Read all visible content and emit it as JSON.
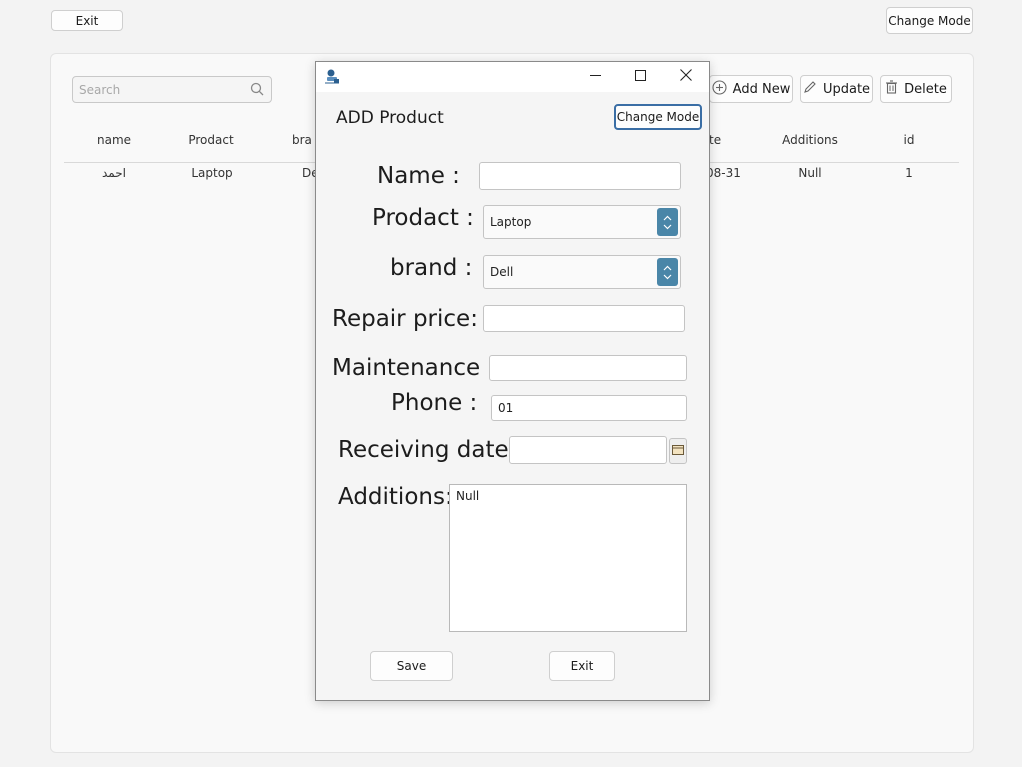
{
  "top": {
    "exit_label": "Exit",
    "change_mode_label": "Change Mode"
  },
  "toolbar": {
    "search_placeholder": "Search",
    "add_label": "Add New",
    "update_label": "Update",
    "delete_label": "Delete"
  },
  "table": {
    "headers": [
      "name",
      "Prodact",
      "bra",
      "te",
      "Additions",
      "id"
    ],
    "rows": [
      {
        "name": "احمد",
        "prodact": "Laptop",
        "brand": "De",
        "date": "08-31",
        "additions": "Null",
        "id": "1"
      }
    ]
  },
  "dialog": {
    "title": "ADD Product",
    "change_mode_label": "Change Mode",
    "labels": {
      "name": "Name :",
      "prodact": "Prodact :",
      "brand": "brand :",
      "repair_price": "Repair price:",
      "maintenance": "Maintenance :",
      "phone": "Phone :",
      "receiving_date": "Receiving date:",
      "additions": "Additions:"
    },
    "values": {
      "name": "",
      "prodact": "Laptop",
      "brand": "Dell",
      "repair_price": "",
      "maintenance": "",
      "phone": "01",
      "receiving_date": "",
      "additions": "Null"
    },
    "save_label": "Save",
    "exit_label": "Exit"
  },
  "colors": {
    "accent": "#3a6ea5",
    "spin_button": "#4a86a8"
  }
}
